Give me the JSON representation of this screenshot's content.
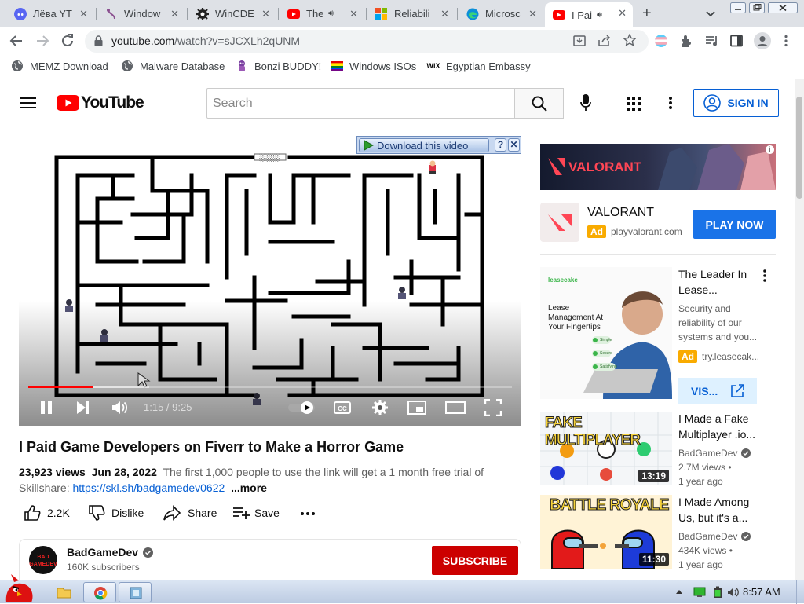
{
  "tabs": [
    {
      "title": "Лёва YT",
      "icon": "discord-icon"
    },
    {
      "title": "Window",
      "icon": "tool-icon"
    },
    {
      "title": "WinCDE",
      "icon": "gear-icon"
    },
    {
      "title": "The",
      "icon": "youtube-icon"
    },
    {
      "title": "Reliabili",
      "icon": "windows-icon"
    },
    {
      "title": "Microsc",
      "icon": "edge-icon"
    },
    {
      "title": "I Pai",
      "icon": "youtube-icon"
    }
  ],
  "browser": {
    "url_host": "youtube.com",
    "url_path": "/watch?v=sJCXLh2qUNM"
  },
  "bookmarks": [
    {
      "label": "MEMZ Download",
      "icon": "globe-icon"
    },
    {
      "label": "Malware Database",
      "icon": "globe-icon"
    },
    {
      "label": "Bonzi BUDDY!",
      "icon": "bonzi-icon"
    },
    {
      "label": "Windows ISOs",
      "icon": "rainbow-flag-icon"
    },
    {
      "label": "Egyptian Embassy",
      "icon": "wix-icon"
    }
  ],
  "youtube": {
    "logo_text": "YouTube",
    "search_placeholder": "Search",
    "signin_label": "SIGN IN"
  },
  "player": {
    "download_label": "Download this video",
    "time": "1:15 / 9:25",
    "progress": 0.133,
    "buffer": 0.25,
    "maze_sign": "░░░░░"
  },
  "video": {
    "title": "I Paid Game Developers on Fiverr to Make a Horror Game",
    "views": "23,923 views",
    "date": "Jun 28, 2022",
    "desc": "The first 1,000 people to use the link will get a 1 month free trial of Skillshare:",
    "link": "https://skl.sh/badgamedev0622",
    "more": "...more",
    "likes": "2.2K",
    "dislike_label": "Dislike",
    "share_label": "Share",
    "save_label": "Save",
    "channel": "BadGameDev",
    "subscribers": "160K subscribers",
    "subscribe_label": "SUBSCRIBE",
    "avatar_text": "BAD GAMEDEV"
  },
  "ad_banner": {
    "brand": "VALORANT"
  },
  "ad": {
    "name": "VALORANT",
    "badge": "Ad",
    "domain": "playvalorant.com",
    "cta": "PLAY NOW"
  },
  "lease_ad": {
    "title": "The Leader In Lease...",
    "desc": "Security and reliability of our systems and you...",
    "badge": "Ad",
    "domain": "try.leasecak...",
    "cta": "VIS...",
    "thumb_brand": "leasecake",
    "thumb_text": "Lease Management At Your Fingertips",
    "thumb_pills": [
      "Simple",
      "Secure",
      "Satisfying"
    ]
  },
  "related": [
    {
      "title": "I Made a Fake Multiplayer .io...",
      "channel": "BadGameDev",
      "views": "2.7M views",
      "age": "1 year ago",
      "duration": "13:19",
      "thumb_text": "FAKE MULTIPLAYER"
    },
    {
      "title": "I Made Among Us, but it's a...",
      "channel": "BadGameDev",
      "views": "434K views",
      "age": "1 year ago",
      "duration": "11:30",
      "thumb_text": "BATTLE ROYALE"
    }
  ],
  "taskbar": {
    "clock": "8:57 AM"
  },
  "colors": {
    "youtube_red": "#ff0000",
    "subscribe_red": "#cc0000",
    "link_blue": "#065fd4",
    "play_now_blue": "#1a73e8"
  }
}
